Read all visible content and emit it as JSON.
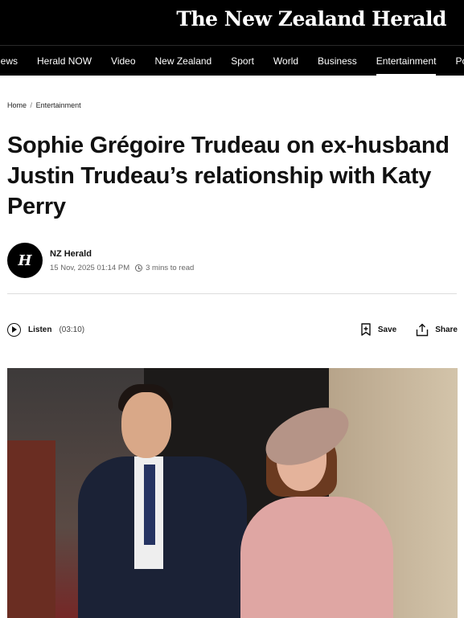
{
  "header": {
    "brand": "The New Zealand Herald"
  },
  "nav": {
    "items": [
      {
        "label": "news"
      },
      {
        "label": "Herald NOW"
      },
      {
        "label": "Video"
      },
      {
        "label": "New Zealand"
      },
      {
        "label": "Sport"
      },
      {
        "label": "World"
      },
      {
        "label": "Business"
      },
      {
        "label": "Entertainment",
        "active": true
      },
      {
        "label": "Po"
      }
    ]
  },
  "breadcrumb": {
    "home": "Home",
    "separator": "/",
    "section": "Entertainment"
  },
  "article": {
    "title": "Sophie Grégoire Trudeau on ex-husband Justin Trudeau’s relationship with Katy Perry",
    "author": {
      "name": "NZ Herald",
      "avatar_letter": "H"
    },
    "date": "15 Nov, 2025 01:14 PM",
    "read_time": "3 mins to read"
  },
  "toolbar": {
    "listen_label": "Listen",
    "listen_duration": "(03:10)",
    "save_label": "Save",
    "share_label": "Share"
  },
  "icons": {
    "play": "play-circle-icon",
    "bookmark": "bookmark-plus-icon",
    "share": "share-icon",
    "clock": "clock-icon"
  },
  "colors": {
    "header_bg": "#000000",
    "text": "#111111",
    "meta": "#666666"
  }
}
